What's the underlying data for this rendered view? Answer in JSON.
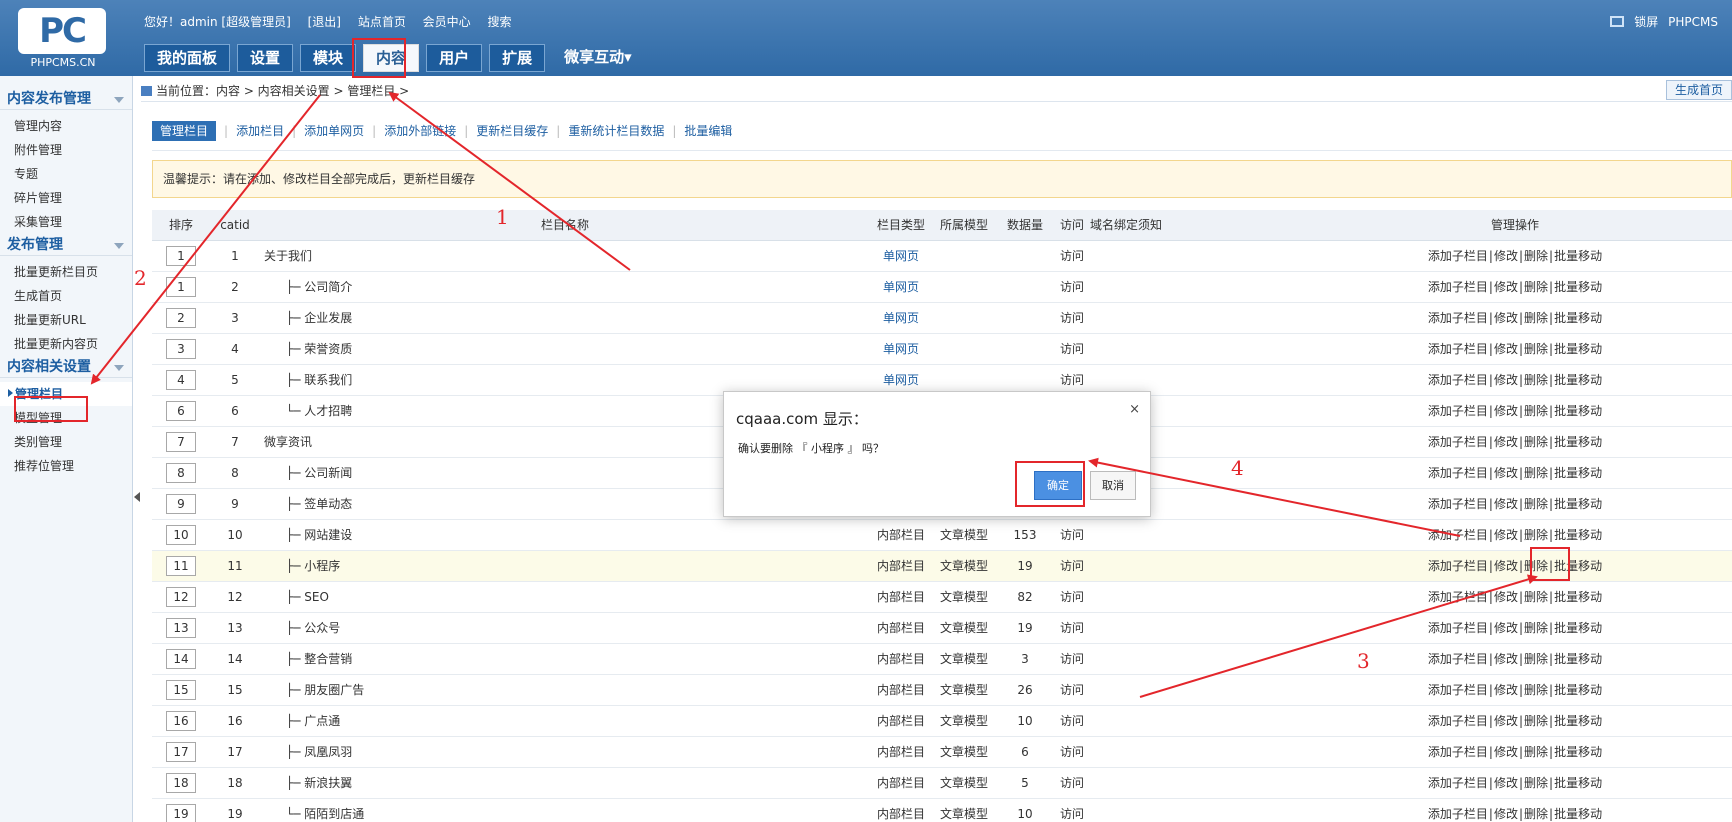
{
  "logo": {
    "mark": "PC",
    "text": "PHPCMS.CN"
  },
  "header": {
    "greeting": "您好！admin [超级管理员]",
    "logout": "[退出]",
    "site_home": "站点首页",
    "member_center": "会员中心",
    "search": "搜索",
    "lock": "锁屏",
    "brand": "PHPCMS"
  },
  "nav": {
    "tabs": [
      "我的面板",
      "设置",
      "模块",
      "内容",
      "用户",
      "扩展",
      "微享互动▾"
    ],
    "active": "内容"
  },
  "sidebar": {
    "sections": [
      {
        "title": "内容发布管理",
        "items": [
          "管理内容",
          "附件管理",
          "专题",
          "碎片管理",
          "采集管理"
        ]
      },
      {
        "title": "发布管理",
        "items": [
          "批量更新栏目页",
          "生成首页",
          "批量更新URL",
          "批量更新内容页"
        ]
      },
      {
        "title": "内容相关设置",
        "items": [
          "管理栏目",
          "模型管理",
          "类别管理",
          "推荐位管理"
        ]
      }
    ],
    "current": "管理栏目"
  },
  "breadcrumb": {
    "text": "当前位置：内容 > 内容相关设置 > 管理栏目 >",
    "gen_button": "生成首页"
  },
  "actions": [
    "管理栏目",
    "添加栏目",
    "添加单网页",
    "添加外部链接",
    "更新栏目缓存",
    "重新统计栏目数据",
    "批量编辑"
  ],
  "tip": "温馨提示：请在添加、修改栏目全部完成后，更新栏目缓存",
  "table": {
    "headers": {
      "order": "排序",
      "catid": "catid",
      "name": "栏目名称",
      "type": "栏目类型",
      "model": "所属模型",
      "count": "数据量",
      "visit": "访问",
      "domain": "域名绑定须知",
      "ops": "管理操作"
    },
    "ops": [
      "添加子栏目",
      "修改",
      "删除",
      "批量移动"
    ],
    "rows": [
      {
        "order": "1",
        "catid": "1",
        "name": "关于我们",
        "type": "单网页",
        "model": "",
        "count": "",
        "visit": "访问"
      },
      {
        "order": "1",
        "catid": "2",
        "name": "├─ 公司简介",
        "type": "单网页",
        "model": "",
        "count": "",
        "visit": "访问"
      },
      {
        "order": "2",
        "catid": "3",
        "name": "├─ 企业发展",
        "type": "单网页",
        "model": "",
        "count": "",
        "visit": "访问"
      },
      {
        "order": "3",
        "catid": "4",
        "name": "├─ 荣誉资质",
        "type": "单网页",
        "model": "",
        "count": "",
        "visit": "访问"
      },
      {
        "order": "4",
        "catid": "5",
        "name": "├─ 联系我们",
        "type": "单网页",
        "model": "",
        "count": "",
        "visit": "访问"
      },
      {
        "order": "6",
        "catid": "6",
        "name": "└─ 人才招聘",
        "type": "",
        "model": "",
        "count": "",
        "visit": "访问"
      },
      {
        "order": "7",
        "catid": "7",
        "name": "微享资讯",
        "type": "",
        "model": "",
        "count": "",
        "visit": "访问"
      },
      {
        "order": "8",
        "catid": "8",
        "name": "├─ 公司新闻",
        "type": "",
        "model": "",
        "count": "",
        "visit": "访问"
      },
      {
        "order": "9",
        "catid": "9",
        "name": "├─ 签单动态",
        "type": "",
        "model": "",
        "count": "",
        "visit": "访问"
      },
      {
        "order": "10",
        "catid": "10",
        "name": "├─ 网站建设",
        "type": "内部栏目",
        "model": "文章模型",
        "count": "153",
        "visit": "访问"
      },
      {
        "order": "11",
        "catid": "11",
        "name": "├─ 小程序",
        "type": "内部栏目",
        "model": "文章模型",
        "count": "19",
        "visit": "访问"
      },
      {
        "order": "12",
        "catid": "12",
        "name": "├─ SEO",
        "type": "内部栏目",
        "model": "文章模型",
        "count": "82",
        "visit": "访问"
      },
      {
        "order": "13",
        "catid": "13",
        "name": "├─ 公众号",
        "type": "内部栏目",
        "model": "文章模型",
        "count": "19",
        "visit": "访问"
      },
      {
        "order": "14",
        "catid": "14",
        "name": "├─ 整合营销",
        "type": "内部栏目",
        "model": "文章模型",
        "count": "3",
        "visit": "访问"
      },
      {
        "order": "15",
        "catid": "15",
        "name": "├─ 朋友圈广告",
        "type": "内部栏目",
        "model": "文章模型",
        "count": "26",
        "visit": "访问"
      },
      {
        "order": "16",
        "catid": "16",
        "name": "├─ 广点通",
        "type": "内部栏目",
        "model": "文章模型",
        "count": "10",
        "visit": "访问"
      },
      {
        "order": "17",
        "catid": "17",
        "name": "├─ 凤凰凤羽",
        "type": "内部栏目",
        "model": "文章模型",
        "count": "6",
        "visit": "访问"
      },
      {
        "order": "18",
        "catid": "18",
        "name": "├─ 新浪扶翼",
        "type": "内部栏目",
        "model": "文章模型",
        "count": "5",
        "visit": "访问"
      },
      {
        "order": "19",
        "catid": "19",
        "name": "└─ 陌陌到店通",
        "type": "内部栏目",
        "model": "文章模型",
        "count": "10",
        "visit": "访问"
      }
    ]
  },
  "dialog": {
    "title": "cqaaa.com 显示：",
    "close": "×",
    "message": "确认要删除 『 小程序 』 吗？",
    "ok": "确定",
    "cancel": "取消"
  },
  "annotations": {
    "labels": [
      "1",
      "2",
      "3",
      "4"
    ],
    "color": "#e3262b"
  }
}
